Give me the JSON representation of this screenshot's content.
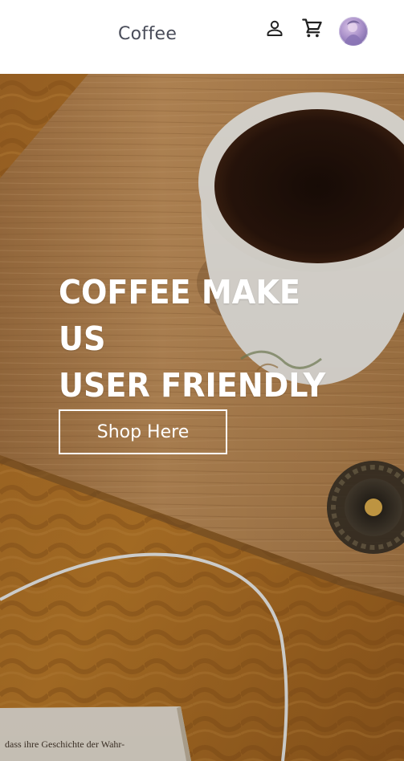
{
  "header": {
    "brand": "Coffee",
    "icons": {
      "account": "account-icon",
      "cart": "cart-icon",
      "avatar": "avatar"
    }
  },
  "hero": {
    "title_line1": "COFFEE MAKE US",
    "title_line2": "USER FRIENDLY",
    "cta_label": "Shop Here",
    "book_text": "dass ihre Geschichte der Wahr-"
  },
  "colors": {
    "brand_text": "#4a4d5a",
    "hero_text": "#ffffff",
    "wood": "#b9874e",
    "knit": "#b87625"
  }
}
